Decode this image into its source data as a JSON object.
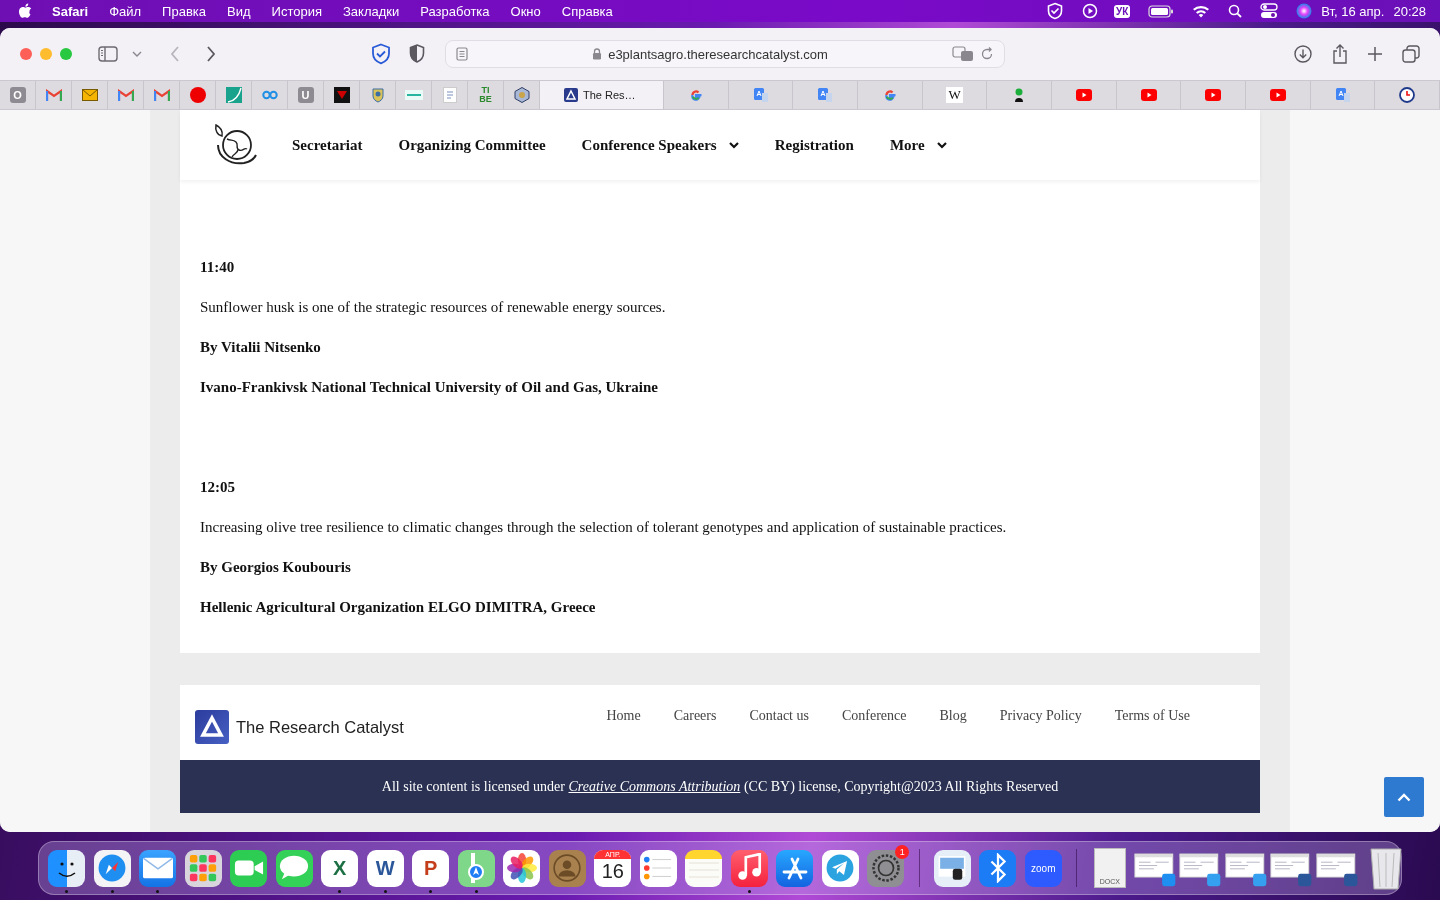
{
  "menu_bar": {
    "app": "Safari",
    "menus": [
      "Файл",
      "Правка",
      "Вид",
      "История",
      "Закладки",
      "Разработка",
      "Окно",
      "Справка"
    ],
    "keyboard": "УК",
    "date": "Вт, 16 апр.",
    "time": "20:28"
  },
  "browser": {
    "url": "e3plantsagro.theresearchcatalyst.com",
    "tabs": [
      {
        "kind": "letter",
        "label": "O",
        "selected": false
      },
      {
        "kind": "gmail",
        "selected": false
      },
      {
        "kind": "envelope",
        "selected": false
      },
      {
        "kind": "gmail",
        "selected": false
      },
      {
        "kind": "gmail",
        "selected": false
      },
      {
        "kind": "red-dot",
        "selected": false
      },
      {
        "kind": "teal-curve",
        "selected": false
      },
      {
        "kind": "infinity",
        "selected": false
      },
      {
        "kind": "letter",
        "label": "U",
        "selected": false
      },
      {
        "kind": "dark-triangle",
        "selected": false
      },
      {
        "kind": "crest",
        "selected": false
      },
      {
        "kind": "stripe",
        "selected": false
      },
      {
        "kind": "page",
        "selected": false
      },
      {
        "kind": "tibe",
        "label": "TI BE",
        "selected": false
      },
      {
        "kind": "hexagon",
        "selected": false
      },
      {
        "kind": "site",
        "label": "The Res…",
        "selected": true
      },
      {
        "kind": "google",
        "selected": false
      },
      {
        "kind": "translate",
        "selected": false
      },
      {
        "kind": "translate",
        "selected": false
      },
      {
        "kind": "google",
        "selected": false
      },
      {
        "kind": "wiki",
        "label": "W",
        "selected": false
      },
      {
        "kind": "person",
        "selected": false
      },
      {
        "kind": "youtube",
        "selected": false
      },
      {
        "kind": "youtube",
        "selected": false
      },
      {
        "kind": "youtube",
        "selected": false
      },
      {
        "kind": "youtube",
        "selected": false
      },
      {
        "kind": "translate",
        "selected": false
      },
      {
        "kind": "clock",
        "selected": false
      }
    ]
  },
  "site_nav": [
    {
      "label": "Secretariat",
      "dropdown": false
    },
    {
      "label": "Organizing Committee",
      "dropdown": false
    },
    {
      "label": "Conference Speakers",
      "dropdown": true
    },
    {
      "label": "Registration",
      "dropdown": false
    },
    {
      "label": "More",
      "dropdown": true
    }
  ],
  "sessions": [
    {
      "time": "11:40",
      "title": "Sunflower husk is one of the strategic resources of renewable energy sources.",
      "speaker": "By Vitalii Nitsenko",
      "affiliation": "Ivano-Frankivsk National Technical University of Oil and Gas, Ukraine"
    },
    {
      "time": "12:05",
      "title": "Increasing olive tree resilience to climatic changes through the selection of tolerant genotypes and application of sustainable practices.",
      "speaker": "By Georgios Koubouris",
      "affiliation": "Hellenic Agricultural Organization ELGO DIMITRA, Greece"
    }
  ],
  "footer": {
    "brand": "The Research Catalyst",
    "links": [
      "Home",
      "Careers",
      "Contact us",
      "Conference",
      "Blog",
      "Privacy Policy",
      "Terms of Use"
    ],
    "license": {
      "before": "All site content is licensed under",
      "link": "Creative Commons Attribution",
      "after": "(CC BY) license, Copyright@2023 All Rights Reserved"
    }
  },
  "dock": {
    "apps": [
      {
        "kind": "finder",
        "running": true
      },
      {
        "kind": "safari",
        "running": true
      },
      {
        "kind": "mail",
        "running": true
      },
      {
        "kind": "launchpad",
        "running": false
      },
      {
        "kind": "facetime",
        "running": false
      },
      {
        "kind": "messages",
        "running": false
      },
      {
        "kind": "excel",
        "label": "X",
        "running": true
      },
      {
        "kind": "word",
        "label": "W",
        "running": true
      },
      {
        "kind": "powerpoint",
        "label": "P",
        "running": true
      },
      {
        "kind": "maps",
        "running": true
      },
      {
        "kind": "photos",
        "running": false
      },
      {
        "kind": "contacts",
        "running": false
      },
      {
        "kind": "calendar",
        "month": "АПР.",
        "day": "16",
        "running": false
      },
      {
        "kind": "reminders",
        "running": false
      },
      {
        "kind": "notes",
        "running": false
      },
      {
        "kind": "music",
        "running": true
      },
      {
        "kind": "appstore",
        "running": false
      },
      {
        "kind": "telegram",
        "running": false
      },
      {
        "kind": "settings",
        "badge": "1",
        "running": false
      }
    ],
    "utilities": [
      {
        "kind": "preview",
        "running": false
      },
      {
        "kind": "bluetooth",
        "running": false
      },
      {
        "kind": "zoom",
        "label": "zoom",
        "running": false
      }
    ],
    "documents": [
      {
        "kind": "document",
        "label": "DOCX"
      },
      {
        "kind": "window-safari"
      },
      {
        "kind": "window-finder"
      },
      {
        "kind": "window-finder"
      },
      {
        "kind": "window-word"
      },
      {
        "kind": "window-word"
      },
      {
        "kind": "trash"
      }
    ]
  }
}
